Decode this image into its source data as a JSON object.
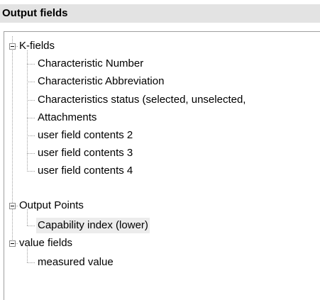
{
  "panel": {
    "title": "Output fields"
  },
  "tree": {
    "k_fields": {
      "label": "K-fields",
      "children": [
        "Characteristic Number",
        "Characteristic Abbreviation",
        "Characteristics status (selected, unselected,",
        "Attachments",
        "user field contents 2",
        "user field contents 3",
        "user field contents 4"
      ]
    },
    "output_points": {
      "label": "Output Points",
      "children": [
        "Capability index (lower)"
      ]
    },
    "value_fields": {
      "label": "value fields",
      "children": [
        "measured value"
      ]
    }
  },
  "colors": {
    "header_bg": "#e3e3e3",
    "selected_bg": "#ececec",
    "tree_lines": "#a0a0a0"
  },
  "icons": {
    "expand_toggle": "minus-box-icon"
  }
}
